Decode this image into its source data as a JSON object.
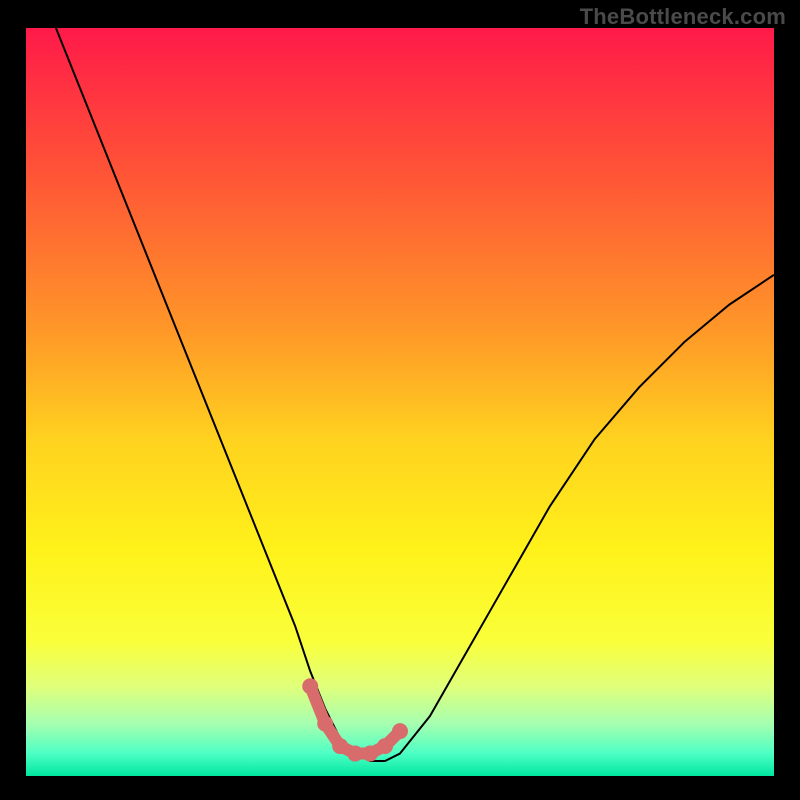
{
  "watermark": "TheBottleneck.com",
  "chart_data": {
    "type": "line",
    "title": "",
    "xlabel": "",
    "ylabel": "",
    "xlim": [
      0,
      100
    ],
    "ylim": [
      0,
      100
    ],
    "axes_visible": false,
    "grid": false,
    "background_gradient": {
      "stops": [
        {
          "offset": 0.0,
          "color": "#ff1a49"
        },
        {
          "offset": 0.2,
          "color": "#ff5636"
        },
        {
          "offset": 0.4,
          "color": "#ff9628"
        },
        {
          "offset": 0.55,
          "color": "#ffd21f"
        },
        {
          "offset": 0.7,
          "color": "#fff21a"
        },
        {
          "offset": 0.82,
          "color": "#f9ff3a"
        },
        {
          "offset": 0.88,
          "color": "#e0ff7a"
        },
        {
          "offset": 0.93,
          "color": "#a6ffb0"
        },
        {
          "offset": 0.97,
          "color": "#4dffc4"
        },
        {
          "offset": 1.0,
          "color": "#00e6a0"
        }
      ]
    },
    "series": [
      {
        "name": "bottleneck-curve",
        "stroke": "#000000",
        "stroke_width": 2,
        "x": [
          4,
          8,
          12,
          16,
          20,
          24,
          28,
          32,
          36,
          38,
          40,
          42,
          44,
          46,
          48,
          50,
          54,
          58,
          62,
          66,
          70,
          76,
          82,
          88,
          94,
          100
        ],
        "y": [
          100,
          90,
          80,
          70,
          60,
          50,
          40,
          30,
          20,
          14,
          9,
          5,
          3,
          2,
          2,
          3,
          8,
          15,
          22,
          29,
          36,
          45,
          52,
          58,
          63,
          67
        ]
      },
      {
        "name": "marker-band",
        "stroke": "#d86b6b",
        "stroke_width": 12,
        "linecap": "round",
        "x": [
          38,
          40,
          42,
          44,
          46,
          48,
          50
        ],
        "y": [
          12,
          7,
          4,
          3,
          3,
          4,
          6
        ]
      }
    ],
    "markers": [
      {
        "x": 38,
        "y": 12,
        "r": 8,
        "color": "#d86b6b"
      },
      {
        "x": 40,
        "y": 7,
        "r": 8,
        "color": "#d86b6b"
      },
      {
        "x": 42,
        "y": 4,
        "r": 8,
        "color": "#d86b6b"
      },
      {
        "x": 44,
        "y": 3,
        "r": 8,
        "color": "#d86b6b"
      },
      {
        "x": 46,
        "y": 3,
        "r": 8,
        "color": "#d86b6b"
      },
      {
        "x": 48,
        "y": 4,
        "r": 8,
        "color": "#d86b6b"
      },
      {
        "x": 50,
        "y": 6,
        "r": 8,
        "color": "#d86b6b"
      }
    ]
  }
}
